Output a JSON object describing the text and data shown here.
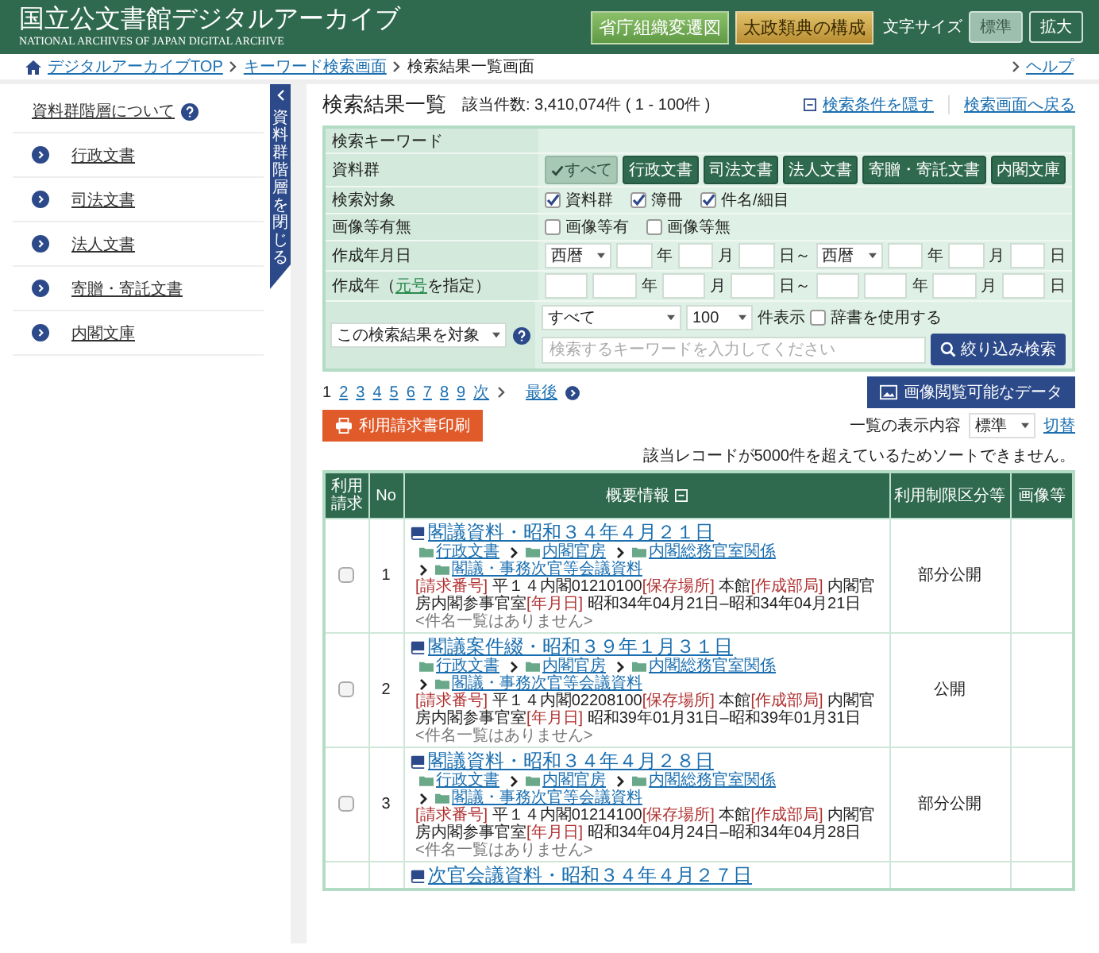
{
  "header": {
    "title": "国立公文書館デジタルアーカイブ",
    "subtitle": "NATIONAL ARCHIVES OF JAPAN  DIGITAL ARCHIVE",
    "buttons": [
      {
        "label": "省庁組織変遷図",
        "kind": "green"
      },
      {
        "label": "太政類典の構成",
        "kind": "gold"
      }
    ],
    "font_size_label": "文字サイズ",
    "font_sizes": [
      {
        "label": "標準",
        "selected": true
      },
      {
        "label": "拡大",
        "selected": false
      }
    ]
  },
  "breadcrumb": {
    "items": [
      "デジタルアーカイブTOP",
      "キーワード検索画面",
      "検索結果一覧画面"
    ],
    "help": "ヘルプ"
  },
  "sidebar": {
    "heading": "資料群階層について",
    "items": [
      "行政文書",
      "司法文書",
      "法人文書",
      "寄贈・寄託文書",
      "内閣文庫"
    ],
    "toggle": "資料群階層を閉じる"
  },
  "results": {
    "title": "検索結果一覧",
    "count": "該当件数: 3,410,074件 ( 1 - 100件 )",
    "hide_link": "検索条件を隠す",
    "back_link": "検索画面へ戻る"
  },
  "search_form": {
    "rows": [
      {
        "kind": "plain",
        "label": "検索キーワード"
      },
      {
        "kind": "toggles",
        "label": "資料群",
        "options": [
          {
            "label": "すべて",
            "selected": true
          },
          {
            "label": "行政文書",
            "selected": false
          },
          {
            "label": "司法文書",
            "selected": false
          },
          {
            "label": "法人文書",
            "selected": false
          },
          {
            "label": "寄贈・寄託文書",
            "selected": false
          },
          {
            "label": "内閣文庫",
            "selected": false
          }
        ]
      },
      {
        "kind": "checks",
        "label": "検索対象",
        "options": [
          {
            "label": "資料群",
            "checked": true
          },
          {
            "label": "簿冊",
            "checked": true
          },
          {
            "label": "件名/細目",
            "checked": true
          }
        ]
      },
      {
        "kind": "checks",
        "label": "画像等有無",
        "options": [
          {
            "label": "画像等有",
            "checked": false
          },
          {
            "label": "画像等無",
            "checked": false
          }
        ]
      },
      {
        "kind": "dates",
        "label": "作成年月日",
        "parts": [
          {
            "kind": "select",
            "value": "西暦"
          },
          {
            "kind": "input"
          },
          {
            "kind": "unit",
            "text": "年"
          },
          {
            "kind": "input"
          },
          {
            "kind": "unit",
            "text": "月"
          },
          {
            "kind": "input"
          },
          {
            "kind": "unit",
            "text": "日～"
          },
          {
            "kind": "select",
            "value": "西暦"
          },
          {
            "kind": "input"
          },
          {
            "kind": "unit",
            "text": "年"
          },
          {
            "kind": "input"
          },
          {
            "kind": "unit",
            "text": "月"
          },
          {
            "kind": "input"
          },
          {
            "kind": "unit",
            "text": "日"
          }
        ]
      },
      {
        "kind": "dates",
        "label": "作成年（",
        "label_link": "元号",
        "label_after": "を指定）",
        "parts": [
          {
            "kind": "input"
          },
          {
            "kind": "input"
          },
          {
            "kind": "unit",
            "text": "年"
          },
          {
            "kind": "input"
          },
          {
            "kind": "unit",
            "text": "月"
          },
          {
            "kind": "input"
          },
          {
            "kind": "unit",
            "text": "日～"
          },
          {
            "kind": "input"
          },
          {
            "kind": "input"
          },
          {
            "kind": "unit",
            "text": "年"
          },
          {
            "kind": "input"
          },
          {
            "kind": "unit",
            "text": "月"
          },
          {
            "kind": "input"
          },
          {
            "kind": "unit",
            "text": "日"
          }
        ]
      }
    ],
    "scope_select": "この検索結果を対象",
    "target_select": "すべて",
    "per_page_select": "100",
    "per_page_label": "件表示",
    "dictionary": {
      "label": "辞書を使用する",
      "checked": false
    },
    "keyword_placeholder": "検索するキーワードを入力してください",
    "submit": "絞り込み検索"
  },
  "pagination": {
    "pages": [
      {
        "label": "1",
        "selected": true
      },
      {
        "label": "2",
        "selected": false
      },
      {
        "label": "3",
        "selected": false
      },
      {
        "label": "4",
        "selected": false
      },
      {
        "label": "5",
        "selected": false
      },
      {
        "label": "6",
        "selected": false
      },
      {
        "label": "7",
        "selected": false
      },
      {
        "label": "8",
        "selected": false
      },
      {
        "label": "9",
        "selected": false
      }
    ],
    "next": "次",
    "last": "最後"
  },
  "image_data_button": "画像閲覧可能なデータ",
  "print_button": "利用請求書印刷",
  "display": {
    "label": "一覧の表示内容",
    "value": "標準",
    "switch": "切替"
  },
  "notice": "該当レコードが5000件を超えているためソートできません。",
  "table": {
    "columns": [
      "利用請求",
      "No",
      "概要情報",
      "利用制限区分等",
      "画像等"
    ],
    "rows": [
      {
        "checked": false,
        "no": "1",
        "title": "閣議資料・昭和３４年４月２１日",
        "path": [
          "行政文書",
          "内閣官房",
          "内閣総務官室関係",
          "閣議・事務次官等会議資料"
        ],
        "details": [
          {
            "label": "[請求番号]",
            "value": "平１４内閣01210100"
          },
          {
            "label": "[保存場所]",
            "value": "本館"
          },
          {
            "label": "[作成部局]",
            "value": "内閣官房内閣参事官室"
          },
          {
            "label": "[年月日]",
            "value": "昭和34年04月21日–昭和34年04月21日"
          }
        ],
        "note": "<件名一覧はありません>",
        "restriction": "部分公開"
      },
      {
        "checked": false,
        "no": "2",
        "title": "閣議案件綴・昭和３９年１月３１日",
        "path": [
          "行政文書",
          "内閣官房",
          "内閣総務官室関係",
          "閣議・事務次官等会議資料"
        ],
        "details": [
          {
            "label": "[請求番号]",
            "value": "平１４内閣02208100"
          },
          {
            "label": "[保存場所]",
            "value": "本館"
          },
          {
            "label": "[作成部局]",
            "value": "内閣官房内閣参事官室"
          },
          {
            "label": "[年月日]",
            "value": "昭和39年01月31日–昭和39年01月31日"
          }
        ],
        "note": "<件名一覧はありません>",
        "restriction": "公開"
      },
      {
        "checked": false,
        "no": "3",
        "title": "閣議資料・昭和３４年４月２８日",
        "path": [
          "行政文書",
          "内閣官房",
          "内閣総務官室関係",
          "閣議・事務次官等会議資料"
        ],
        "details": [
          {
            "label": "[請求番号]",
            "value": "平１４内閣01214100"
          },
          {
            "label": "[保存場所]",
            "value": "本館"
          },
          {
            "label": "[作成部局]",
            "value": "内閣官房内閣参事官室"
          },
          {
            "label": "[年月日]",
            "value": "昭和34年04月24日–昭和34年04月28日"
          }
        ],
        "note": "<件名一覧はありません>",
        "restriction": "部分公開"
      },
      {
        "title": "次官会議資料・昭和３４年４月２７日"
      }
    ]
  }
}
